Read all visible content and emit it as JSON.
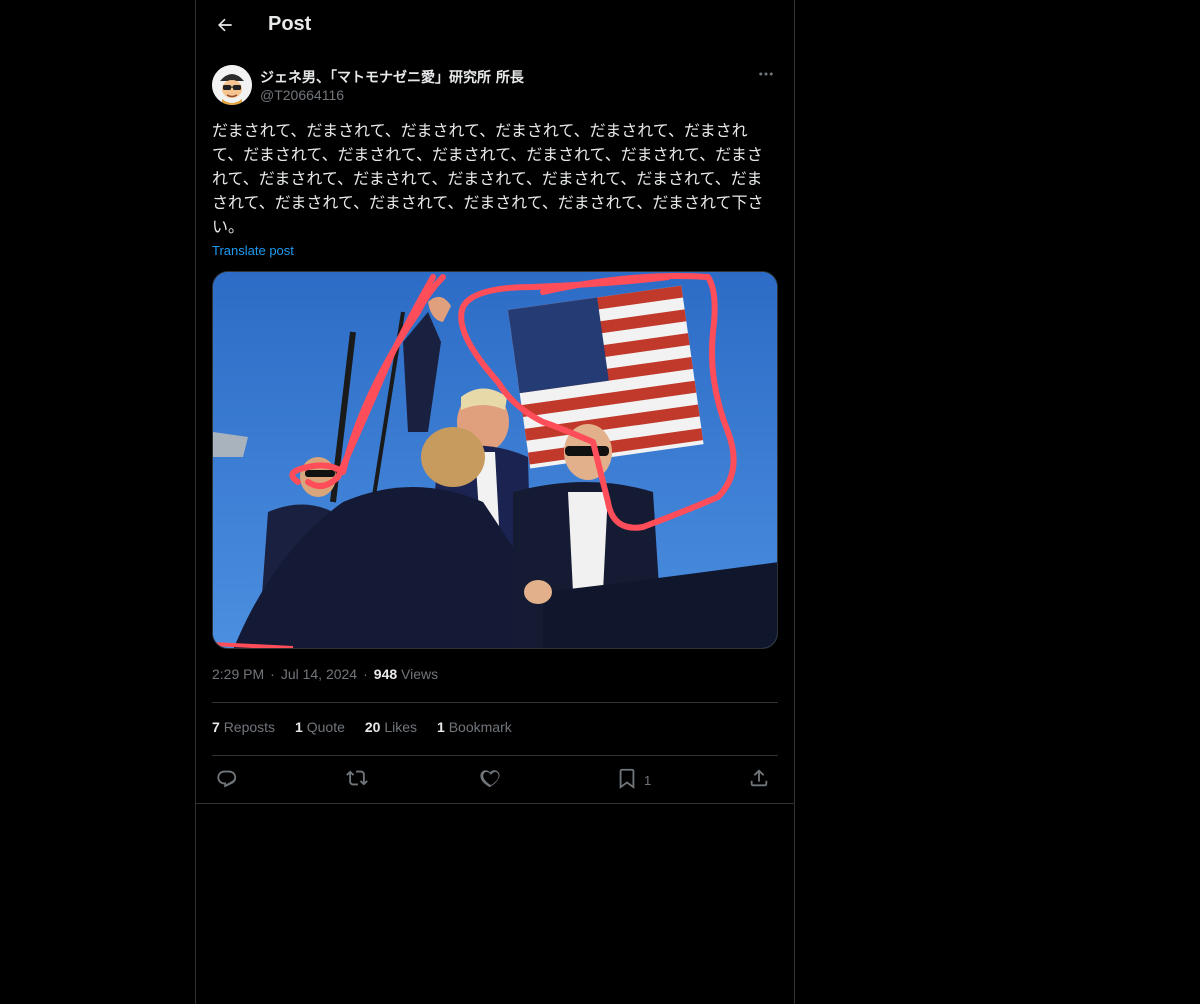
{
  "header": {
    "title": "Post",
    "back_icon": "arrow-left-icon"
  },
  "author": {
    "display_name": "ジェネ男、「マトモナゼニ愛」研究所 所長",
    "handle": "@T20664116",
    "avatar_icon": "avatar-cartoon-icon",
    "more_icon": "more-horizontal-icon"
  },
  "post": {
    "text": "だまされて、だまされて、だまされて、だまされて、だまされて、だまされて、だまされて、だまされて、だまされて、だまされて、だまされて、だまされて、だまされて、だまされて、だまされて、だまされて、だまされて、だまされて、だまされて、だまされて、だまされて、だまされて、だまされて下さい。",
    "translate_label": "Translate post"
  },
  "meta": {
    "time": "2:29 PM",
    "date": "Jul 14, 2024",
    "views_count": "948",
    "views_label": "Views"
  },
  "stats": [
    {
      "count": "7",
      "label": "Reposts"
    },
    {
      "count": "1",
      "label": "Quote"
    },
    {
      "count": "20",
      "label": "Likes"
    },
    {
      "count": "1",
      "label": "Bookmark"
    }
  ],
  "actions": {
    "reply_icon": "reply-icon",
    "repost_icon": "repost-icon",
    "like_icon": "heart-icon",
    "bookmark_icon": "bookmark-icon",
    "bookmark_count": "1",
    "share_icon": "share-icon"
  },
  "colors": {
    "background": "#000000",
    "text": "#e7e9ea",
    "muted": "#71767b",
    "accent": "#1d9bf0",
    "border": "#2f3336",
    "annotation": "#ff4d5a"
  }
}
